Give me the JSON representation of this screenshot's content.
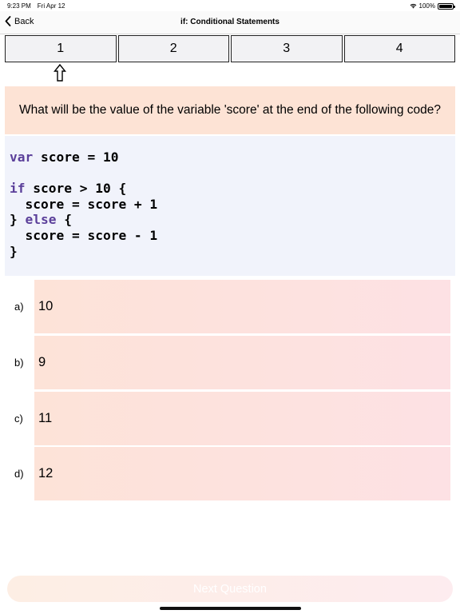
{
  "status_bar": {
    "time": "9:23 PM",
    "date": "Fri Apr 12",
    "battery": "100%",
    "battery_level": 1.0,
    "icons": [
      "wifi-icon",
      "battery-icon"
    ]
  },
  "nav": {
    "back_label": "Back",
    "back_icon": "chevron-left-icon",
    "title": "if: Conditional Statements"
  },
  "question_tabs": [
    {
      "label": "1",
      "current": true
    },
    {
      "label": "2",
      "current": false
    },
    {
      "label": "3",
      "current": false
    },
    {
      "label": "4",
      "current": false
    }
  ],
  "current_indicator_icon": "up-arrow-icon",
  "question": {
    "text": "What will be the value of the variable 'score' at the end of the following code?"
  },
  "code": {
    "lines": [
      [
        {
          "t": "var",
          "kw": true
        },
        {
          "t": " score = 10",
          "kw": false
        }
      ],
      [],
      [
        {
          "t": "if",
          "kw": true
        },
        {
          "t": " score > 10 {",
          "kw": false
        }
      ],
      [
        {
          "t": "  score = score + 1",
          "kw": false
        }
      ],
      [
        {
          "t": "} ",
          "kw": false
        },
        {
          "t": "else",
          "kw": true
        },
        {
          "t": " {",
          "kw": false
        }
      ],
      [
        {
          "t": "  score = score - 1",
          "kw": false
        }
      ],
      [
        {
          "t": "}",
          "kw": false
        }
      ]
    ]
  },
  "answers": [
    {
      "letter": "a)",
      "text": "10"
    },
    {
      "letter": "b)",
      "text": "9"
    },
    {
      "letter": "c)",
      "text": "11"
    },
    {
      "letter": "d)",
      "text": "12"
    }
  ],
  "next_button": {
    "label": "Next Question"
  },
  "colors": {
    "keyword": "#5b3f9a",
    "question_bg": "#fde3d5",
    "code_bg": "#f1f3fb",
    "answer_bg": "#fde1e0"
  }
}
